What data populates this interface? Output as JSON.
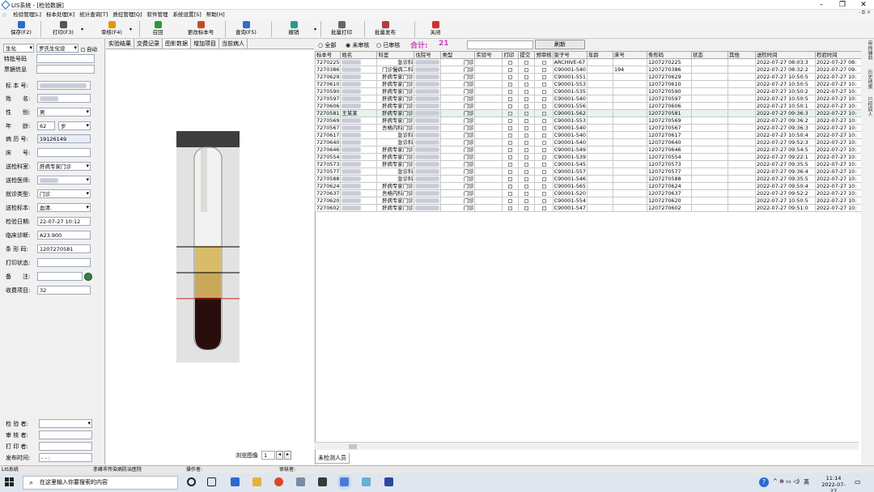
{
  "window": {
    "title": "LIS系统 - [检验数据]",
    "min": "–",
    "max": "❐",
    "close": "✕"
  },
  "menu": [
    "检验管理[L]",
    "标本处理[K]",
    "统计查询[T]",
    "质控管理[Q]",
    "软件管理",
    "系统设置[S]",
    "帮助[H]"
  ],
  "menu_right": "- ⧉ ✕",
  "toolbar": [
    {
      "label": "保存(F2)",
      "color": "#2b6cd1"
    },
    {
      "label": "打印(F3)",
      "color": "#555"
    },
    {
      "label": "审核(F4)",
      "color": "#e09a00"
    },
    {
      "label": "召回",
      "color": "#2a9a3a"
    },
    {
      "label": "更改标本号",
      "color": "#c84a2a"
    },
    {
      "label": "查询(F5)",
      "color": "#3a6ac8"
    },
    {
      "label": "撤销",
      "color": "#2a9a8a"
    },
    {
      "label": "批量打印",
      "color": "#666"
    },
    {
      "label": "批量发布",
      "color": "#b04040"
    },
    {
      "label": "关闭",
      "color": "#d03030"
    }
  ],
  "left": {
    "instrument": "生化",
    "instrument_name": "罗氏生化设",
    "auto_label": "自动",
    "special_label": "特批号码",
    "ticket_label": "票据信息",
    "fields": [
      {
        "label": "标 本 号:",
        "value": "1207270581",
        "blur": true
      },
      {
        "label": "姓　　名:",
        "value": "王某某",
        "blur": true
      },
      {
        "label": "性　　别:",
        "value": "男",
        "dropdown": true
      },
      {
        "label": "年　　龄:",
        "value": "62",
        "unit": "岁"
      },
      {
        "label": "病 历 号:",
        "value": "19126149",
        "gray": true
      },
      {
        "label": "床　　号:",
        "value": ""
      },
      {
        "label": "送检科室:",
        "value": "肝病专家门诊",
        "dropdown": true
      },
      {
        "label": "送检医师:",
        "value": "某医生",
        "dropdown": true,
        "blur": true
      },
      {
        "label": "就诊类型:",
        "value": "门诊",
        "dropdown": true
      },
      {
        "label": "送检标本:",
        "value": "血清.",
        "dropdown": true
      },
      {
        "label": "检验日期:",
        "value": "22-07-27 10:12"
      },
      {
        "label": "临床诊断:",
        "value": "A23.900"
      },
      {
        "label": "条 形 码:",
        "value": "1207270581"
      },
      {
        "label": "打印状态:",
        "value": ""
      },
      {
        "label": "备　　注:",
        "value": ""
      },
      {
        "label": "收费项目:",
        "value": "32"
      }
    ],
    "bottom": [
      {
        "label": "检 验 者:",
        "value": ""
      },
      {
        "label": "审 核 者:",
        "value": ""
      },
      {
        "label": "打 印 者:",
        "value": ""
      },
      {
        "label": "发布时间:",
        "value": "-  -   :"
      }
    ]
  },
  "mid": {
    "tabs": [
      "实验结果",
      "交费记录",
      "图影数据",
      "增加项目",
      "当前病人"
    ],
    "active_tab": 2,
    "browse_label": "浏览图像",
    "browse_value": "1"
  },
  "filter": {
    "all": "全部",
    "unreviewed": "未审核",
    "reviewed": "已审核",
    "total_label": "合计:",
    "total": "21",
    "refresh": "刷新"
  },
  "table": {
    "headers": [
      "标本号",
      "姓名",
      "科室",
      "住院号",
      "类型",
      "实验号",
      "打印",
      "提交",
      "预审核",
      "架子号",
      "年龄",
      "床号",
      "条形码",
      "状态",
      "其他",
      "送检时间",
      "检验时间"
    ],
    "rows": [
      [
        "7270225",
        "",
        "急诊科",
        "",
        "门诊",
        "ARCHIVE-67",
        "",
        "1207270225",
        "2022-07-27 08:03:3",
        "2022-07-27 08:"
      ],
      [
        "7270386",
        "",
        "门诊慢病二科",
        "",
        "门诊",
        "C90001-540",
        "194",
        "1207270386",
        "2022-07-27 08:32:2",
        "2022-07-27 09:"
      ],
      [
        "7270629",
        "",
        "肝病专家门诊",
        "",
        "门诊",
        "C90001-551",
        "",
        "1207270629",
        "2022-07-27 10:50:5",
        "2022-07-27 10:"
      ],
      [
        "7270610",
        "",
        "肝病专家门诊",
        "",
        "门诊",
        "C90001-553",
        "",
        "1207270610",
        "2022-07-27 10:50:5",
        "2022-07-27 10:"
      ],
      [
        "7270590",
        "",
        "肝病专家门诊",
        "",
        "门诊",
        "C90001-535",
        "",
        "1207270590",
        "2022-07-27 10:50:2",
        "2022-07-27 10:"
      ],
      [
        "7270597",
        "",
        "肝病专家门诊",
        "",
        "门诊",
        "C90001-540",
        "",
        "1207270597",
        "2022-07-27 10:50:5",
        "2022-07-27 10:"
      ],
      [
        "7270606",
        "",
        "肝病专家门诊",
        "",
        "门诊",
        "C90001-556",
        "",
        "1207270606",
        "2022-07-27 10:50:1",
        "2022-07-27 10:"
      ],
      [
        "7270581",
        "王某某",
        "肝病专家门诊",
        "",
        "门诊",
        "C90001-562",
        "",
        "1207270581",
        "2022-07-27 09:36:3",
        "2022-07-27 10:"
      ],
      [
        "7270569",
        "",
        "肝病专家门诊",
        "",
        "门诊",
        "C90001-553",
        "",
        "1207270569",
        "2022-07-27 09:36:2",
        "2022-07-27 10:"
      ],
      [
        "7270567",
        "",
        "吾格内科门诊",
        "",
        "门诊",
        "C90001-540",
        "",
        "1207270567",
        "2022-07-27 09:36:3",
        "2022-07-27 10:"
      ],
      [
        "7270617",
        "",
        "急诊科",
        "",
        "门诊",
        "C90001-540",
        "",
        "1207270617",
        "2022-07-27 10:50:4",
        "2022-07-27 10:"
      ],
      [
        "7270640",
        "",
        "急诊科",
        "",
        "门诊",
        "C90001-540",
        "",
        "1207270640",
        "2022-07-27 09:52:3",
        "2022-07-27 10:"
      ],
      [
        "7270646",
        "",
        "肝病专家门诊",
        "",
        "门诊",
        "C90001-549",
        "",
        "1207270646",
        "2022-07-27 09:54:5",
        "2022-07-27 10:"
      ],
      [
        "7270554",
        "",
        "肝病专家门诊",
        "",
        "门诊",
        "C90001-539",
        "",
        "1207270554",
        "2022-07-27 09:22:1",
        "2022-07-27 10:"
      ],
      [
        "7270573",
        "",
        "肝病专家门诊",
        "",
        "门诊",
        "C90001-545",
        "",
        "1207270573",
        "2022-07-27 09:35:5",
        "2022-07-27 10:"
      ],
      [
        "7270577",
        "",
        "急诊科",
        "",
        "门诊",
        "C90001-557",
        "",
        "1207270577",
        "2022-07-27 09:36:4",
        "2022-07-27 10:"
      ],
      [
        "7270588",
        "",
        "急诊科",
        "",
        "门诊",
        "C90001-546",
        "",
        "1207270588",
        "2022-07-27 09:35:5",
        "2022-07-27 10:"
      ],
      [
        "7270624",
        "",
        "肝病专家门诊",
        "",
        "门诊",
        "C90001-565",
        "",
        "1207270624",
        "2022-07-27 09:50:4",
        "2022-07-27 10:"
      ],
      [
        "7270637",
        "",
        "吾格内科门诊",
        "",
        "门诊",
        "C90001-520",
        "",
        "1207270637",
        "2022-07-27 09:52:2",
        "2022-07-27 10:"
      ],
      [
        "7270620",
        "",
        "肝病专家门诊",
        "",
        "门诊",
        "C90001-554",
        "",
        "1207270620",
        "2022-07-27 10:50:5",
        "2022-07-27 10:"
      ],
      [
        "7270602",
        "",
        "肝病专家门诊",
        "",
        "门诊",
        "C90001-547",
        "",
        "1207270602",
        "2022-07-27 09:51:0",
        "2022-07-27 10:"
      ]
    ],
    "selected": 7
  },
  "bottom_tab": "未检测人员",
  "right_tabs": [
    "审核辅助",
    "历史结果",
    "已检病人"
  ],
  "status": {
    "app": "LIS系统",
    "hospital": "赤峰市传染病防治医院",
    "operator_label": "操作者:",
    "reviewer_label": "审核者:"
  },
  "taskbar": {
    "search": "在这里输入你要搜索的内容",
    "time": "11:14",
    "date": "2022-07-27",
    "ime": "英",
    "help": "?"
  }
}
